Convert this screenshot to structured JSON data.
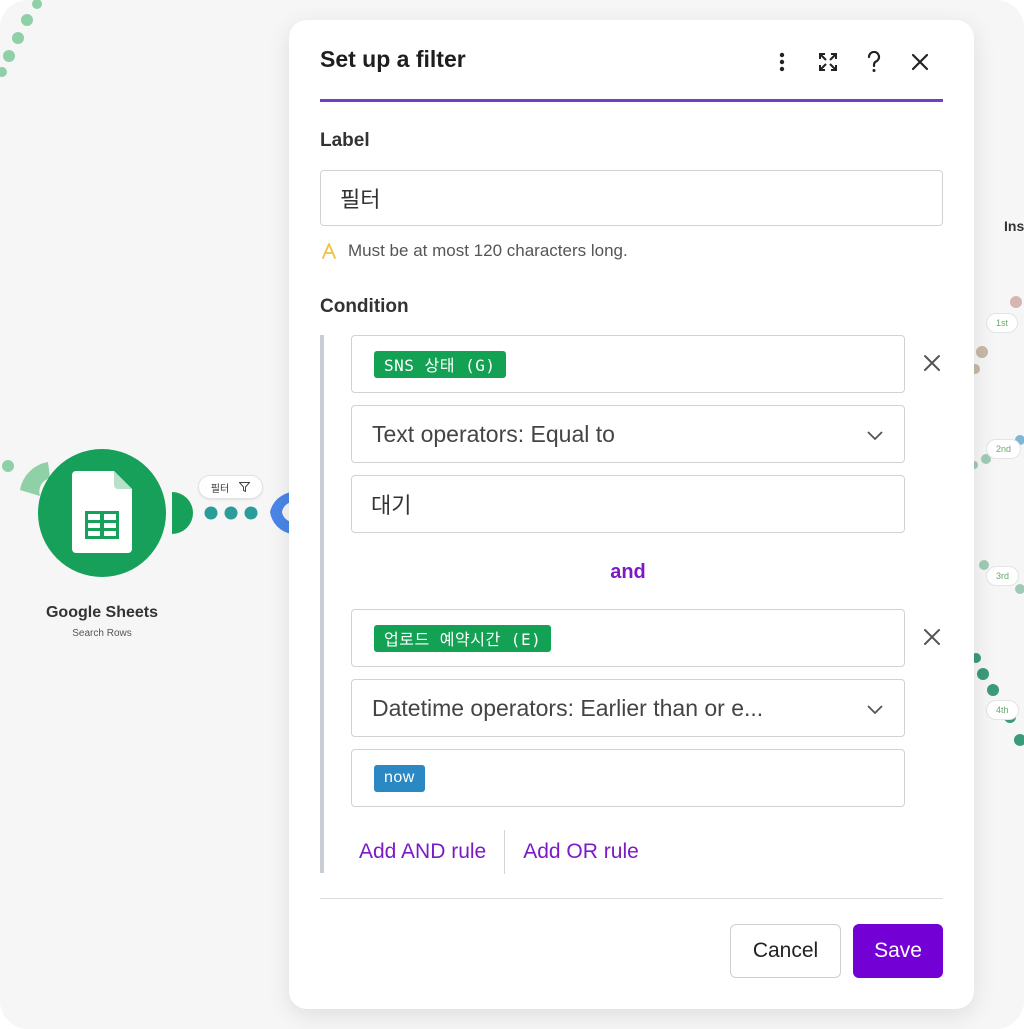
{
  "canvas": {
    "module": {
      "title": "Google Sheets",
      "subtitle": "Search Rows",
      "icon": "google-sheets-icon",
      "color": "#16a05a"
    },
    "filter_pill": {
      "label": "필터",
      "icon": "funnel-icon"
    },
    "right_label": "Ins",
    "routes": [
      {
        "label": "1st"
      },
      {
        "label": "2nd"
      },
      {
        "label": "3rd"
      },
      {
        "label": "4th"
      }
    ]
  },
  "modal": {
    "title": "Set up a filter",
    "header_icons": [
      "more-vertical-icon",
      "expand-icon",
      "help-icon",
      "close-icon"
    ],
    "label_section": {
      "heading": "Label",
      "value": "필터",
      "hint_icon": "translate-warning-icon",
      "hint": "Must be at most 120 characters long."
    },
    "condition_section": {
      "heading": "Condition",
      "rules": [
        {
          "field_token": "SNS 상태 (G)",
          "operator": "Text operators: Equal to",
          "value": "대기"
        },
        {
          "field_token": "업로드 예약시간 (E)",
          "operator": "Datetime operators: Earlier than or e...",
          "value_token": "now"
        }
      ],
      "joiner": "and",
      "add_and": "Add AND rule",
      "add_or": "Add OR rule"
    },
    "buttons": {
      "cancel": "Cancel",
      "save": "Save"
    },
    "colors": {
      "accent": "#7300d4",
      "link": "#7a1bc5",
      "header_line": "#6d3fc4",
      "token_green": "#13a153",
      "token_blue": "#2b88c2"
    }
  }
}
